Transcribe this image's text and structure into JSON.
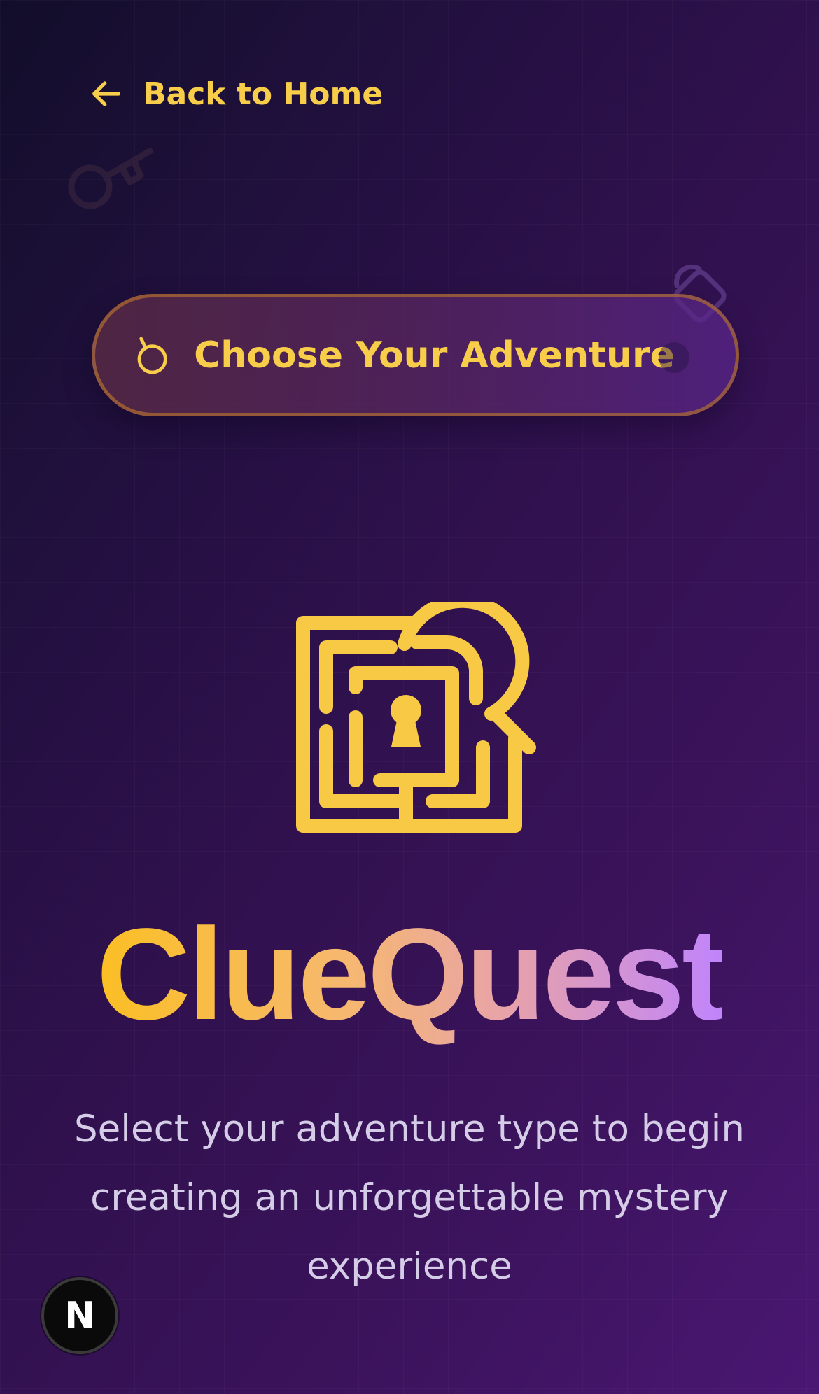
{
  "nav": {
    "back_label": "Back to Home",
    "back_icon": "arrow-left-icon"
  },
  "decorations": {
    "key_icon": "key-icon",
    "lock_icon": "padlock-icon"
  },
  "hero": {
    "pill_label": "Choose Your Adventure",
    "pill_icon": "compass-icon",
    "logo_icon": "maze-keyhole-magnifier-icon",
    "brand_name": "ClueQuest",
    "tagline": "Select your adventure type to begin creating an unforgettable mystery experience"
  },
  "dev_badge": {
    "letter": "N"
  },
  "colors": {
    "accent_gold": "#f7cd4a",
    "gradient_start": "#fbbf24",
    "gradient_end": "#c084fc",
    "background_dark": "#120e2a",
    "background_purple": "#4a1772",
    "tagline_text": "#d5cde8"
  }
}
